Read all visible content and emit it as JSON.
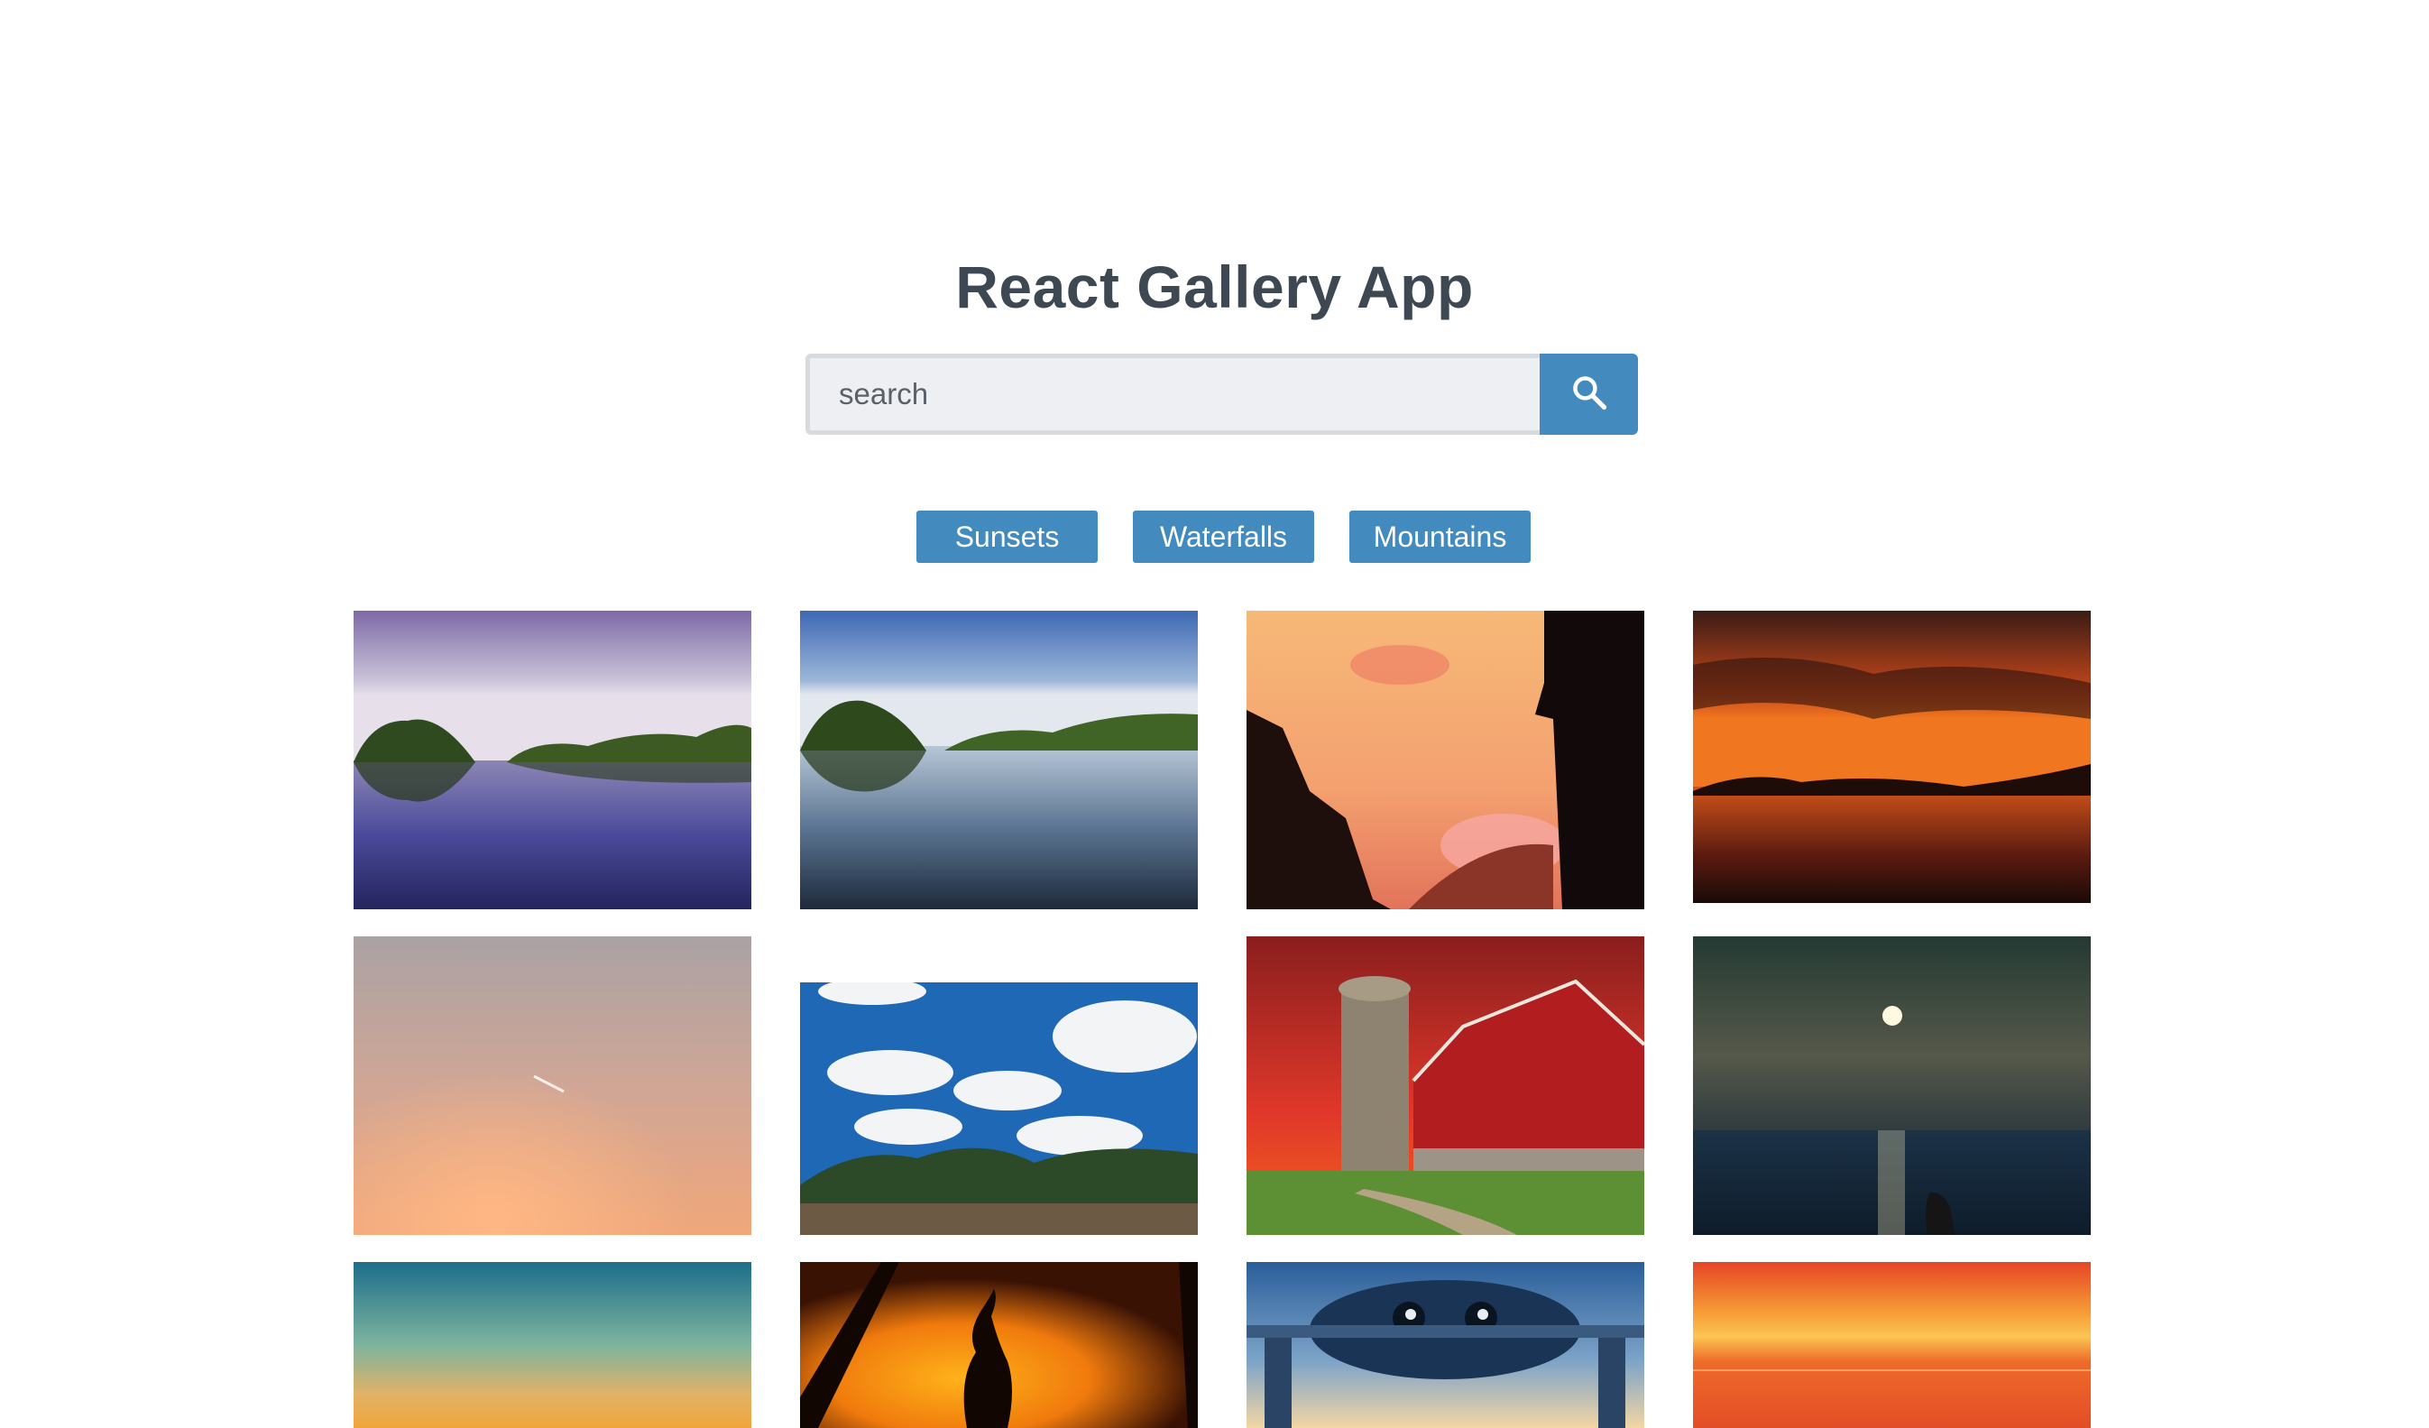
{
  "header": {
    "title": "React Gallery App"
  },
  "search": {
    "placeholder": "search",
    "button_icon": "search-icon"
  },
  "nav": {
    "items": [
      "Sunsets",
      "Waterfalls",
      "Mountains"
    ]
  },
  "colors": {
    "accent": "#438bbf",
    "title": "#3d4852",
    "input_bg": "#edeff2",
    "input_border": "#d7dbe0"
  }
}
